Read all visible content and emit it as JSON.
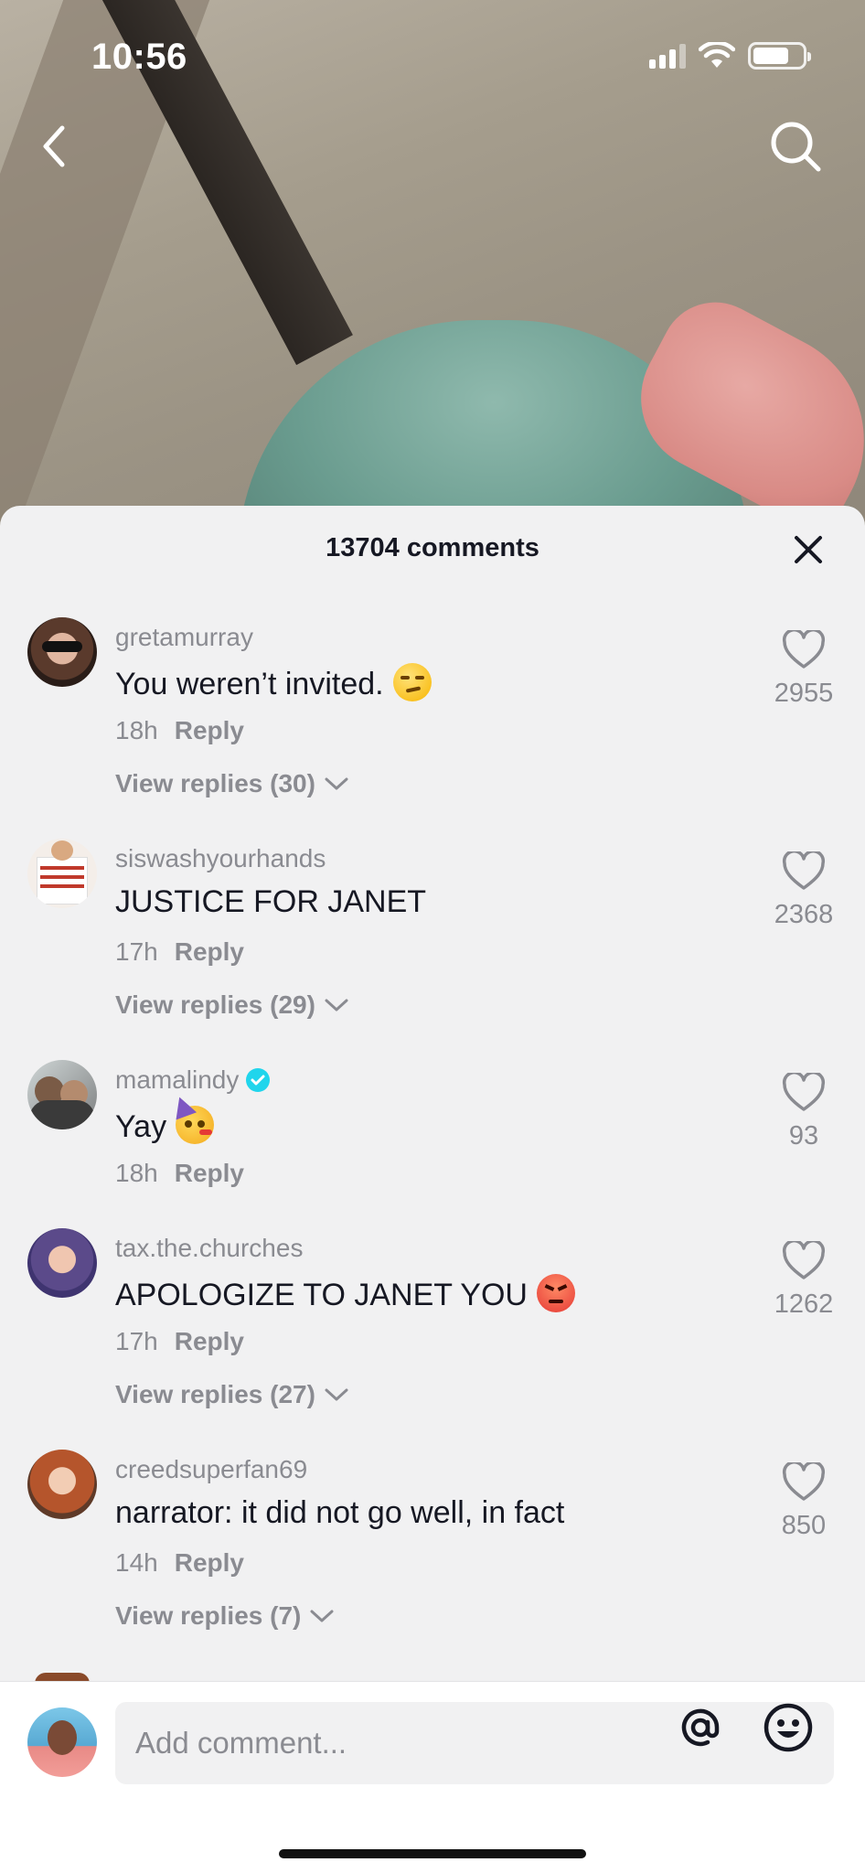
{
  "status_bar": {
    "time": "10:56"
  },
  "sheet": {
    "title": "13704 comments"
  },
  "comments": [
    {
      "user": "gretamurray",
      "text": "You weren’t invited.",
      "emoji": "smirk-emoji",
      "time": "18h",
      "reply": "Reply",
      "view_replies": "View replies (30)",
      "likes": "2955"
    },
    {
      "user": "siswashyourhands",
      "text": "JUSTICE FOR JANET",
      "time": "17h",
      "reply": "Reply",
      "view_replies": "View replies (29)",
      "likes": "2368"
    },
    {
      "user": "mamalindy",
      "verified": true,
      "text": "Yay",
      "emoji": "party-face-emoji",
      "time": "18h",
      "reply": "Reply",
      "likes": "93"
    },
    {
      "user": "tax.the.churches",
      "text": "APOLOGIZE TO JANET YOU",
      "emoji": "angry-face-emoji",
      "time": "17h",
      "reply": "Reply",
      "view_replies": "View replies (27)",
      "likes": "1262"
    },
    {
      "user": "creedsuperfan69",
      "text": "narrator: it did not go well, in fact",
      "time": "14h",
      "reply": "Reply",
      "view_replies": "View replies (7)",
      "likes": "850"
    }
  ],
  "input": {
    "placeholder": "Add comment..."
  },
  "colors": {
    "muted": "#8a8b91",
    "text": "#161823",
    "verified": "#20d5ec",
    "sheet": "#f1f1f2"
  }
}
